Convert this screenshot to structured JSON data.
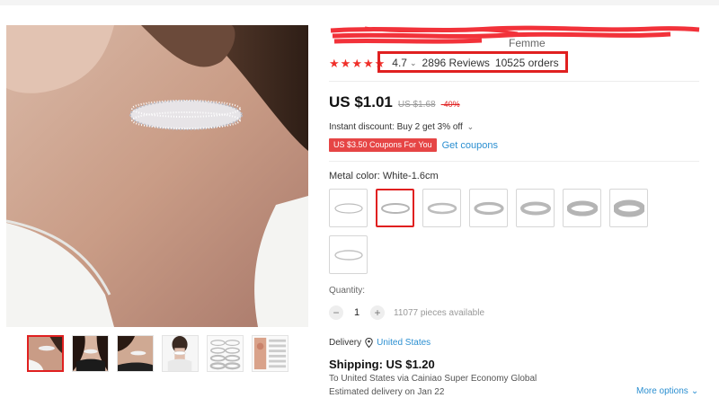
{
  "product": {
    "title_visible_tail": "Femme",
    "rating": {
      "value": "4.7",
      "stars": 5,
      "reviews": "2896 Reviews",
      "orders": "10525 orders"
    },
    "price": {
      "current": "US $1.01",
      "original": "US $1.68",
      "discount": "-40%"
    },
    "instant_discount": "Instant discount: Buy 2 get 3% off",
    "coupon": {
      "badge": "US $3.50 Coupons For You",
      "link": "Get coupons"
    },
    "metal_color": {
      "label": "Metal color: White-1.6cm",
      "options": [
        {
          "name": "swatch-1",
          "selected": false
        },
        {
          "name": "swatch-2",
          "selected": true
        },
        {
          "name": "swatch-3",
          "selected": false
        },
        {
          "name": "swatch-4",
          "selected": false
        },
        {
          "name": "swatch-5",
          "selected": false
        },
        {
          "name": "swatch-6",
          "selected": false
        },
        {
          "name": "swatch-7",
          "selected": false
        },
        {
          "name": "swatch-8",
          "selected": false
        }
      ]
    },
    "quantity": {
      "label": "Quantity:",
      "value": "1",
      "minus": "−",
      "plus": "+",
      "available": "11077 pieces available"
    },
    "delivery": {
      "label": "Delivery",
      "country": "United States"
    },
    "shipping": {
      "cost": "Shipping: US $1.20",
      "via": "To United States via Cainiao Super Economy Global",
      "estimated": "Estimated delivery on Jan 22",
      "more_options": "More options"
    },
    "thumbnails_count": 6
  },
  "colors": {
    "accent_red": "#e02020",
    "link_blue": "#2b8fd1",
    "star_red": "#f0302a",
    "coupon_bg": "#e64545"
  },
  "icons": {
    "star": "star-icon",
    "chevron": "chevron-down-icon",
    "location": "location-pin-icon"
  }
}
